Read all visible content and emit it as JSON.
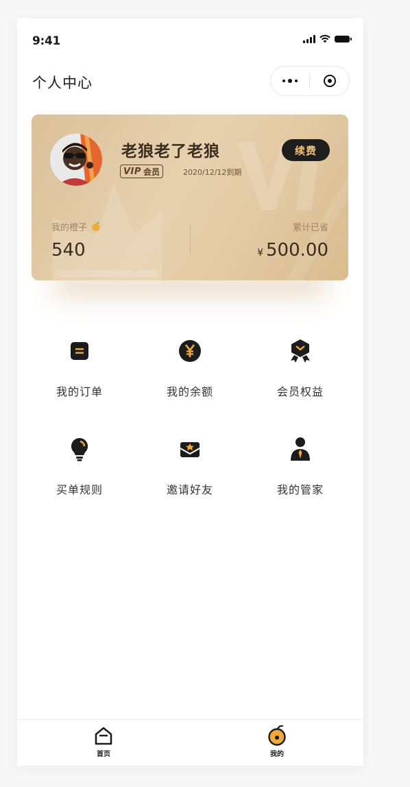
{
  "status_bar": {
    "time": "9:41"
  },
  "nav": {
    "title": "个人中心"
  },
  "vip_card": {
    "user_name": "老狼老了老狼",
    "badge_vip": "VIP",
    "badge_member": "会员",
    "expiry": "2020/12/12到期",
    "renew_label": "续费",
    "orange_label": "我的橙子",
    "orange_count": "540",
    "saved_label": "累计已省",
    "currency": "¥",
    "saved_amount": "500.00"
  },
  "grid": [
    {
      "label": "我的订单",
      "icon": "order-icon"
    },
    {
      "label": "我的余额",
      "icon": "yen-coin-icon"
    },
    {
      "label": "会员权益",
      "icon": "medal-icon"
    },
    {
      "label": "买单规则",
      "icon": "lightbulb-icon"
    },
    {
      "label": "邀请好友",
      "icon": "invite-envelope-icon"
    },
    {
      "label": "我的管家",
      "icon": "butler-person-icon"
    }
  ],
  "tabbar": {
    "tabs": [
      {
        "label": "首页",
        "icon": "home-icon"
      },
      {
        "label": "我的",
        "icon": "orange-fruit-icon",
        "active": true
      }
    ]
  },
  "colors": {
    "card_gold": "#dcc19a",
    "accent_orange": "#f2a93b",
    "dark": "#1e1e1e",
    "renew_text": "#f0c27a"
  }
}
